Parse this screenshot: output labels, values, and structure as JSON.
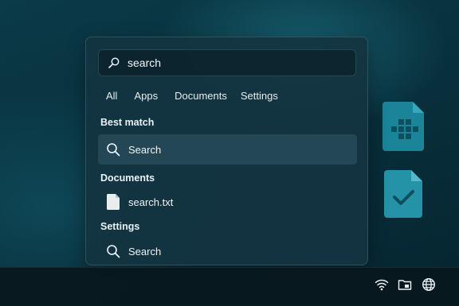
{
  "search": {
    "query": "search",
    "icon": "search-icon"
  },
  "filters": [
    {
      "label": "All"
    },
    {
      "label": "Apps"
    },
    {
      "label": "Documents"
    },
    {
      "label": "Settings"
    }
  ],
  "best_match": {
    "heading": "Best match",
    "item": {
      "label": "Search",
      "icon": "search-icon"
    }
  },
  "documents": {
    "heading": "Documents",
    "items": [
      {
        "label": "search.txt",
        "icon": "file-icon"
      }
    ]
  },
  "settings": {
    "heading": "Settings",
    "items": [
      {
        "label": "Search",
        "icon": "search-icon"
      }
    ]
  },
  "desktop": {
    "icons": [
      {
        "icon": "spreadsheet-file-icon"
      },
      {
        "icon": "checked-document-icon"
      }
    ]
  },
  "taskbar": {
    "tray_icons": [
      "wifi-icon",
      "folder-icon",
      "globe-icon"
    ]
  },
  "colors": {
    "accent": "#2fb4c9",
    "panel": "#143440",
    "taskbar": "#08181e"
  }
}
